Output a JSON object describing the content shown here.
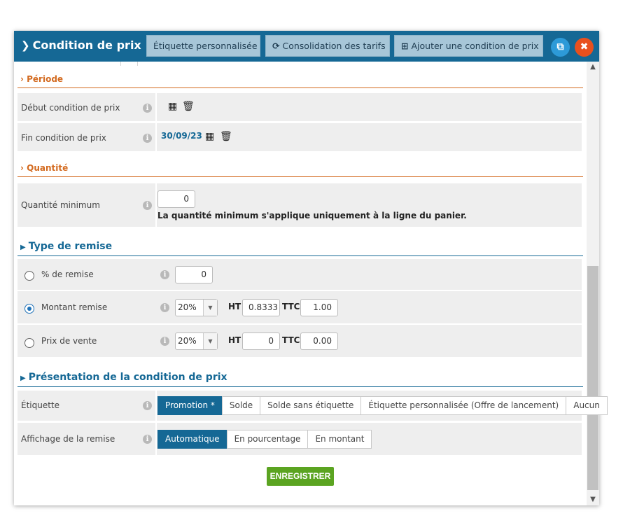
{
  "header": {
    "title": "Condition de prix",
    "btn_custom_label": "Étiquette personnalisée",
    "btn_consolidation": "Consolidation des tarifs",
    "btn_add_condition": "Ajouter une condition de prix",
    "copy_icon": "copy-icon",
    "close_icon": "close-icon",
    "colors": {
      "bar": "#156895",
      "close": "#e8501e",
      "copy": "#2d9ad8"
    }
  },
  "periode": {
    "title": "› Période",
    "start_label": "Début condition de prix",
    "end_label": "Fin condition de prix",
    "end_value": "30/09/23"
  },
  "quantite": {
    "title": "› Quantité",
    "min_label": "Quantité minimum",
    "min_value": "0",
    "min_hint": "La quantité minimum s'applique uniquement à la ligne du panier."
  },
  "remise": {
    "title": "Type de remise",
    "pct_label": "% de remise",
    "pct_value": "0",
    "montant_label": "Montant remise",
    "montant_vat": "20%",
    "montant_ht": "0.8333",
    "montant_ttc": "1.00",
    "prix_label": "Prix de vente",
    "prix_vat": "20%",
    "prix_ht": "0",
    "prix_ttc": "0.00",
    "ht_label": "HT",
    "ttc_label": "TTC",
    "selected": "Montant remise"
  },
  "presentation": {
    "title": "Présentation de la condition de prix",
    "etiquette_label": "Étiquette",
    "etiquette_options": [
      "Promotion *",
      "Solde",
      "Solde sans étiquette",
      "Étiquette personnalisée (Offre de lancement)",
      "Aucun"
    ],
    "etiquette_selected": "Promotion *",
    "affichage_label": "Affichage de la remise",
    "affichage_options": [
      "Automatique",
      "En pourcentage",
      "En montant"
    ],
    "affichage_selected": "Automatique"
  },
  "save_label": "ENREGISTRER",
  "save_color": "#5ba421"
}
